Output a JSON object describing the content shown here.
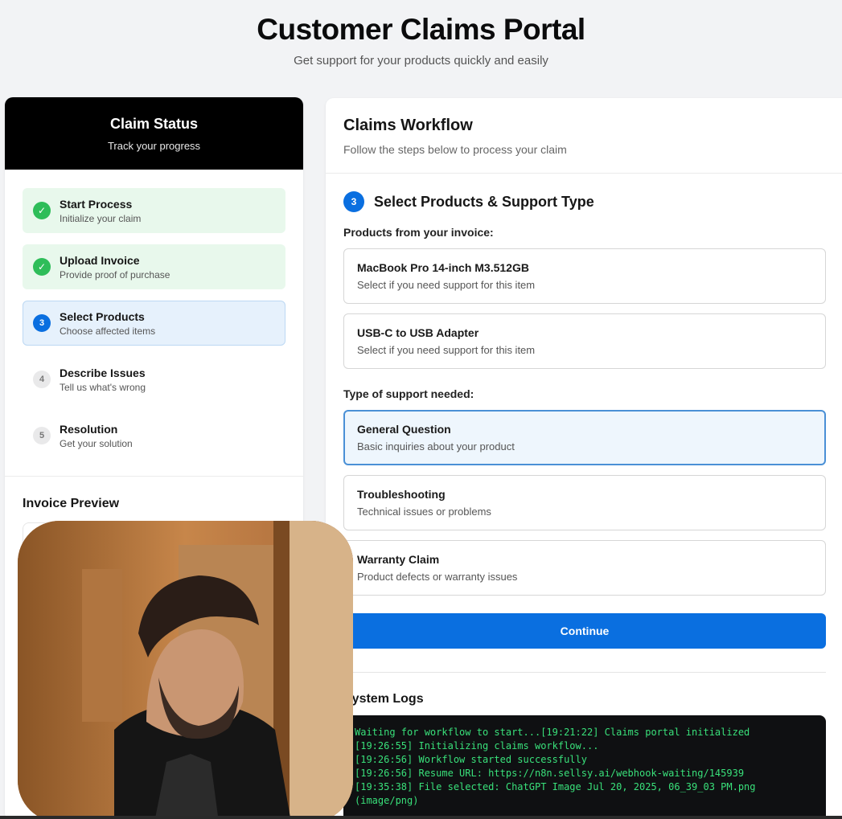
{
  "header": {
    "title": "Customer Claims Portal",
    "subtitle": "Get support for your products quickly and easily"
  },
  "status": {
    "title": "Claim Status",
    "subtitle": "Track your progress",
    "steps": [
      {
        "title": "Start Process",
        "desc": "Initialize your claim",
        "state": "done",
        "marker": "✓"
      },
      {
        "title": "Upload Invoice",
        "desc": "Provide proof of purchase",
        "state": "done",
        "marker": "✓"
      },
      {
        "title": "Select Products",
        "desc": "Choose affected items",
        "state": "active",
        "marker": "3"
      },
      {
        "title": "Describe Issues",
        "desc": "Tell us what's wrong",
        "state": "pending",
        "marker": "4"
      },
      {
        "title": "Resolution",
        "desc": "Get your solution",
        "state": "pending",
        "marker": "5"
      }
    ],
    "invoice_title": "Invoice Preview"
  },
  "workflow": {
    "title": "Claims Workflow",
    "desc": "Follow the steps below to process your claim",
    "step_number": "3",
    "section_title": "Select Products & Support Type",
    "products_label": "Products from your invoice:",
    "products": [
      {
        "title": "MacBook Pro 14-inch M3.512GB",
        "desc": "Select if you need support for this item"
      },
      {
        "title": "USB-C to USB Adapter",
        "desc": "Select if you need support for this item"
      }
    ],
    "support_label": "Type of support needed:",
    "support_types": [
      {
        "title": "General Question",
        "desc": "Basic inquiries about your product",
        "selected": true
      },
      {
        "title": "Troubleshooting",
        "desc": "Technical issues or problems",
        "selected": false
      },
      {
        "title": "Warranty Claim",
        "desc": "Product defects or warranty issues",
        "selected": false
      }
    ],
    "continue_label": "Continue",
    "logs_title": "System Logs",
    "logs": [
      "Waiting for workflow to start...[19:21:22] Claims portal initialized",
      "[19:26:55] Initializing claims workflow...",
      "[19:26:56] Workflow started successfully",
      "[19:26:56] Resume URL: https://n8n.sellsy.ai/webhook-waiting/145939",
      "[19:35:38] File selected: ChatGPT Image Jul 20, 2025, 06_39_03 PM.png",
      "(image/png)"
    ]
  },
  "colors": {
    "accent": "#0a6fe0",
    "done_green": "#2ebd59",
    "done_bg": "#e8f8ec",
    "active_bg": "#e6f1fc",
    "log_text": "#39e07a",
    "status_header": "#000000"
  },
  "icons": {
    "done": "check-circle-icon"
  }
}
